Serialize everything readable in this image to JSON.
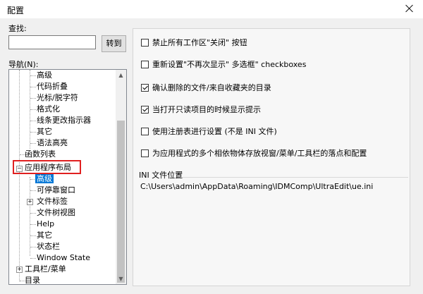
{
  "window": {
    "title": "配置"
  },
  "search": {
    "label": "查找:",
    "value": "",
    "placeholder": "",
    "goto_label": "转到"
  },
  "nav": {
    "label": "导航(N):",
    "items": [
      {
        "label": "高级"
      },
      {
        "label": "代码折叠"
      },
      {
        "label": "光标/脱字符"
      },
      {
        "label": "格式化"
      },
      {
        "label": "线条更改指示器"
      },
      {
        "label": "其它"
      },
      {
        "label": "语法高亮"
      },
      {
        "label": "函数列表"
      },
      {
        "label": "应用程序布局"
      },
      {
        "label": "高级"
      },
      {
        "label": "可停靠窗口"
      },
      {
        "label": "文件标签"
      },
      {
        "label": "文件树视图"
      },
      {
        "label": "Help"
      },
      {
        "label": "其它"
      },
      {
        "label": "状态栏"
      },
      {
        "label": "Window State"
      },
      {
        "label": "工具栏/菜单"
      },
      {
        "label": "目录"
      }
    ]
  },
  "options": [
    {
      "label": "禁止所有工作区\"关闭\" 按钮",
      "checked": false
    },
    {
      "label": "重新设置\"不再次显示\" 多选框\" checkboxes",
      "checked": false
    },
    {
      "label": "确认删除的文件/来自收藏夹的目录",
      "checked": true
    },
    {
      "label": "当打开只读项目的时候显示提示",
      "checked": true
    },
    {
      "label": "使用注册表进行设置 (不是 INI 文件)",
      "checked": false
    },
    {
      "label": "为应用程式的多个相依物体存放视窗/菜单/工具栏的落点和配置",
      "checked": false
    }
  ],
  "ini": {
    "label": "INI 文件位置",
    "path": "C:\\Users\\admin\\AppData\\Roaming\\IDMComp\\UltraEdit\\ue.ini"
  },
  "colors": {
    "selection": "#0078d7",
    "highlight_box": "#e02020"
  }
}
